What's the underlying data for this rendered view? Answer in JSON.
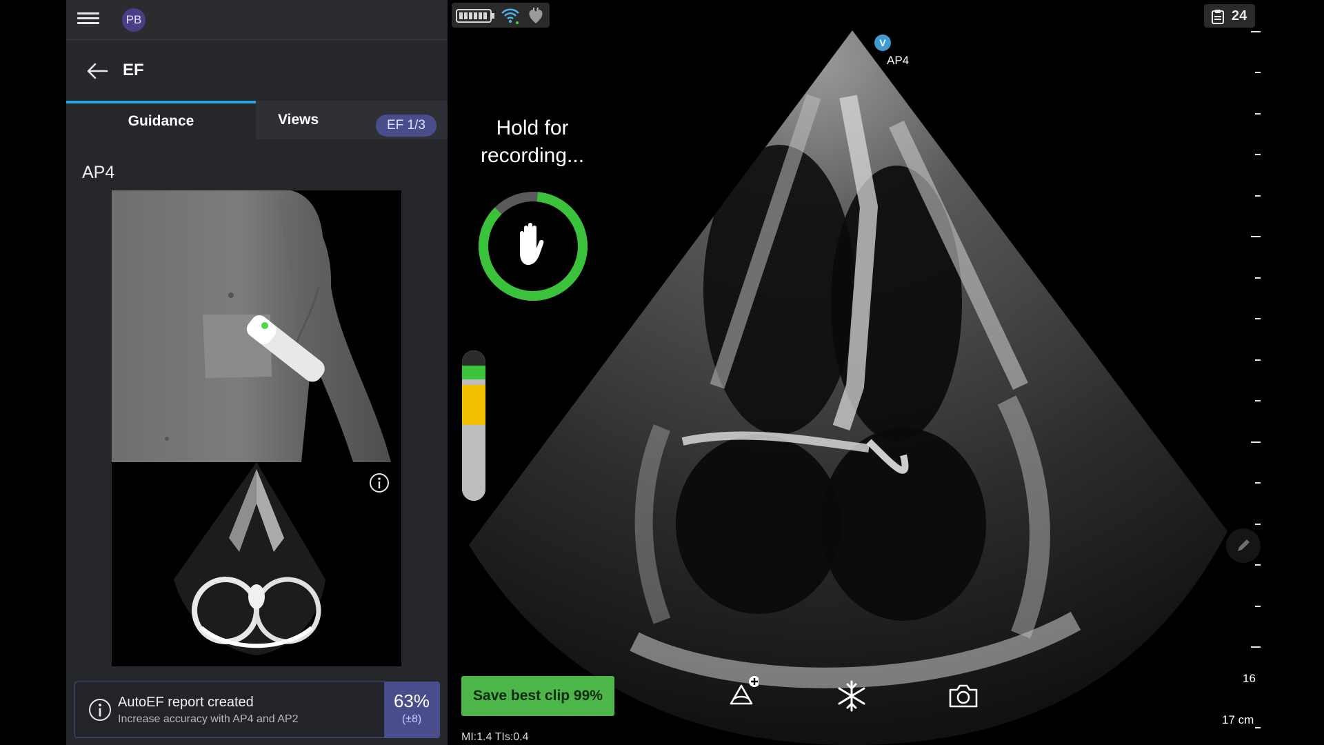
{
  "app": {
    "user_initials": "PB",
    "header_title": "EF"
  },
  "tabs": [
    {
      "label": "Guidance",
      "active": true
    },
    {
      "label": "Views",
      "active": false
    }
  ],
  "ef_badge": "EF 1/3",
  "guidance": {
    "view_label": "AP4"
  },
  "autoef": {
    "title": "AutoEF report created",
    "subtitle": "Increase accuracy with AP4 and AP2",
    "percent": "63%",
    "confidence": "(±8)"
  },
  "status": {
    "clip_count": "24",
    "battery_icon": "battery-icon",
    "wifi_icon": "wifi-icon",
    "heart_icon": "heart-icon"
  },
  "scan": {
    "hold_text": "Hold for recording...",
    "probe_marker": "V",
    "view_tag": "AP4",
    "save_label": "Save best clip 99%",
    "mi_tis": "MI:1.4  TIs:0.4",
    "depth_marker": "16",
    "depth_total": "17 cm"
  },
  "quality_meter": {
    "green_fraction": 0.09,
    "yellow_fraction": 0.27
  },
  "colors": {
    "accent_blue": "#28a6e3",
    "badge_purple": "#4a4d8c",
    "save_green": "#4cb748",
    "ring_green": "#3ac23a",
    "meter_yellow": "#f2c200"
  }
}
